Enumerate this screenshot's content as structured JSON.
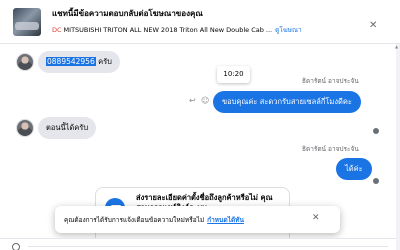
{
  "header": {
    "title": "แชทนี้มีข้อความตอบกลับต่อโฆษณาของคุณ",
    "ad_chip": "ⅮⅭ",
    "ad_text": "MITSUBISHI TRITON ALL NEW 2018 Triton All New Double Cab ...",
    "view_ad_link": "ดูโฆษณา"
  },
  "messages": {
    "m1": {
      "highlight": "0889542956",
      "suffix": " ครับ"
    },
    "tooltip_time": "10:20",
    "m2": {
      "sender": "ธิดารัตน์ อาจประจัน",
      "text": "ขอบคุณค่ะ สะดวกรับสายเซลล์กี่โมงดีคะ"
    },
    "m3": {
      "text": "ตอนนี้ได้ครับ"
    },
    "m4": {
      "sender": "ธิดารัตน์ อาจประจัน",
      "text": "ได้ค่ะ"
    }
  },
  "card": {
    "text": "ส่งรายละเอียดค่าตั้งชื่อถึงลูกค้าหรือไม่ คุณสามารถแชร์ลิงก์ระบบ"
  },
  "toast": {
    "text": "คุณต้องการได้รับการแจ้งเตือนข้อความใหม่หรือไม่",
    "link": "กำหนดได้ทัน"
  },
  "icons": {
    "close": "close-icon",
    "reply": "reply-icon",
    "emoji": "emoji-icon"
  },
  "colors": {
    "accent": "#1b74e4",
    "incoming_bubble": "#e4e6eb"
  }
}
